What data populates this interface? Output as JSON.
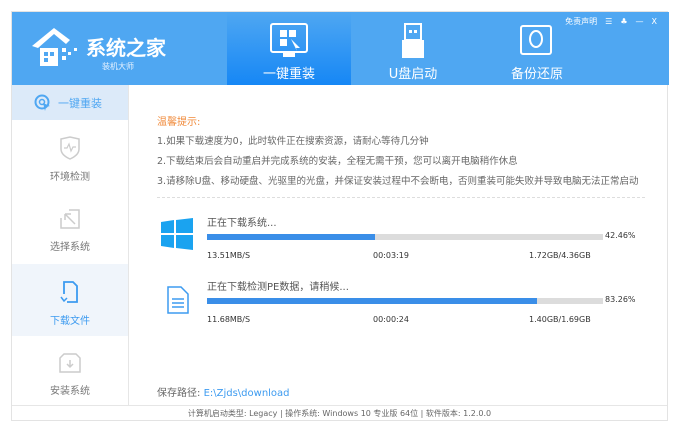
{
  "app": {
    "title": "系统之家",
    "subtitle": "装机大师"
  },
  "top_links": {
    "disclaimer": "免责声明",
    "minimize": "—",
    "close": "X"
  },
  "tabs": [
    {
      "label": "一键重装"
    },
    {
      "label": "U盘启动"
    },
    {
      "label": "备份还原"
    }
  ],
  "sidebar": {
    "header": "一键重装",
    "items": [
      {
        "label": "环境检测"
      },
      {
        "label": "选择系统"
      },
      {
        "label": "下载文件"
      },
      {
        "label": "安装系统"
      }
    ]
  },
  "tips": {
    "title": "温馨提示:",
    "lines": [
      "1.如果下载速度为0，此时软件正在搜索资源，请耐心等待几分钟",
      "2.下载结束后会自动重启并完成系统的安装，全程无需干预，您可以离开电脑稍作休息",
      "3.请移除U盘、移动硬盘、光驱里的光盘，并保证安装过程中不会断电，否则重装可能失败并导致电脑无法正常启动"
    ]
  },
  "downloads": [
    {
      "title": "正在下载系统...",
      "percent_text": "42.46%",
      "progress": 42.46,
      "speed": "13.51MB/S",
      "time": "00:03:19",
      "size": "1.72GB/4.36GB"
    },
    {
      "title": "正在下载检测PE数据，请稍候...",
      "percent_text": "83.26%",
      "progress": 83.26,
      "speed": "11.68MB/S",
      "time": "00:00:24",
      "size": "1.40GB/1.69GB"
    }
  ],
  "save_path": {
    "label": "保存路径:",
    "value": "E:\\Zjds\\download"
  },
  "footer": "计算机启动类型: Legacy | 操作系统: Windows 10 专业版 64位 | 软件版本: 1.2.0.0"
}
